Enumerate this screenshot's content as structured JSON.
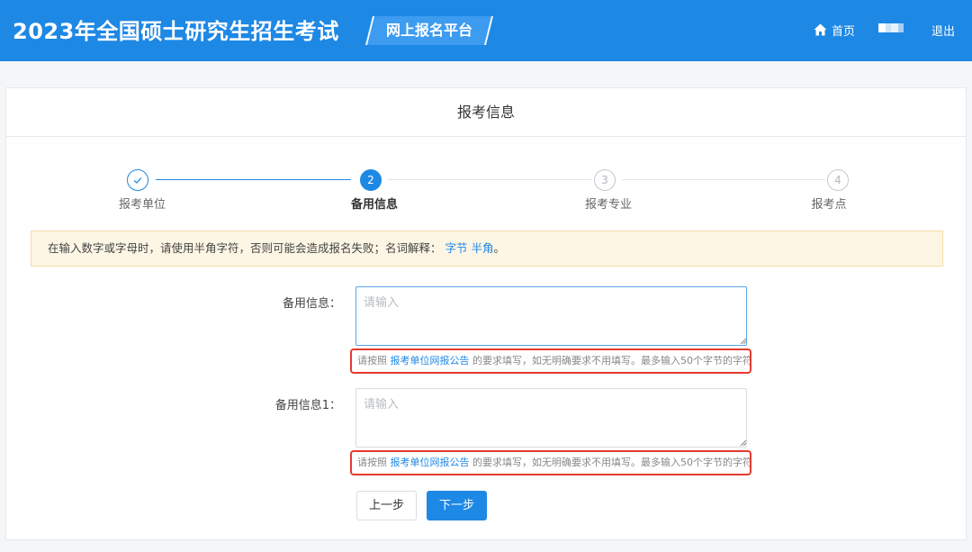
{
  "header": {
    "brand": "2023年全国硕士研究生招生考试",
    "platform": "网上报名平台",
    "nav": {
      "home": "首页",
      "logout": "退出"
    }
  },
  "card": {
    "title": "报考信息",
    "steps": [
      {
        "label": "报考单位",
        "number": "✓",
        "state": "done"
      },
      {
        "label": "备用信息",
        "number": "2",
        "state": "active"
      },
      {
        "label": "报考专业",
        "number": "3",
        "state": "pending"
      },
      {
        "label": "报考点",
        "number": "4",
        "state": "pending"
      }
    ],
    "notice": {
      "text": "在输入数字或字母时，请使用半角字符，否则可能会造成报名失败；名词解释：",
      "link1": "字节",
      "link2": "半角",
      "end": "。"
    }
  },
  "form": {
    "field1": {
      "label": "备用信息：",
      "placeholder": "请输入"
    },
    "field2": {
      "label": "备用信息1：",
      "placeholder": "请输入"
    },
    "hint": {
      "prefix": "请按照 ",
      "link": "报考单位网报公告",
      "suffix": " 的要求填写，如无明确要求不用填写。最多输入50个字节的字符"
    },
    "buttons": {
      "prev": "上一步",
      "next": "下一步"
    }
  },
  "colors": {
    "primary": "#1e88e5",
    "highlight": "#e53a2f",
    "notice_bg": "#fdf6e4"
  }
}
